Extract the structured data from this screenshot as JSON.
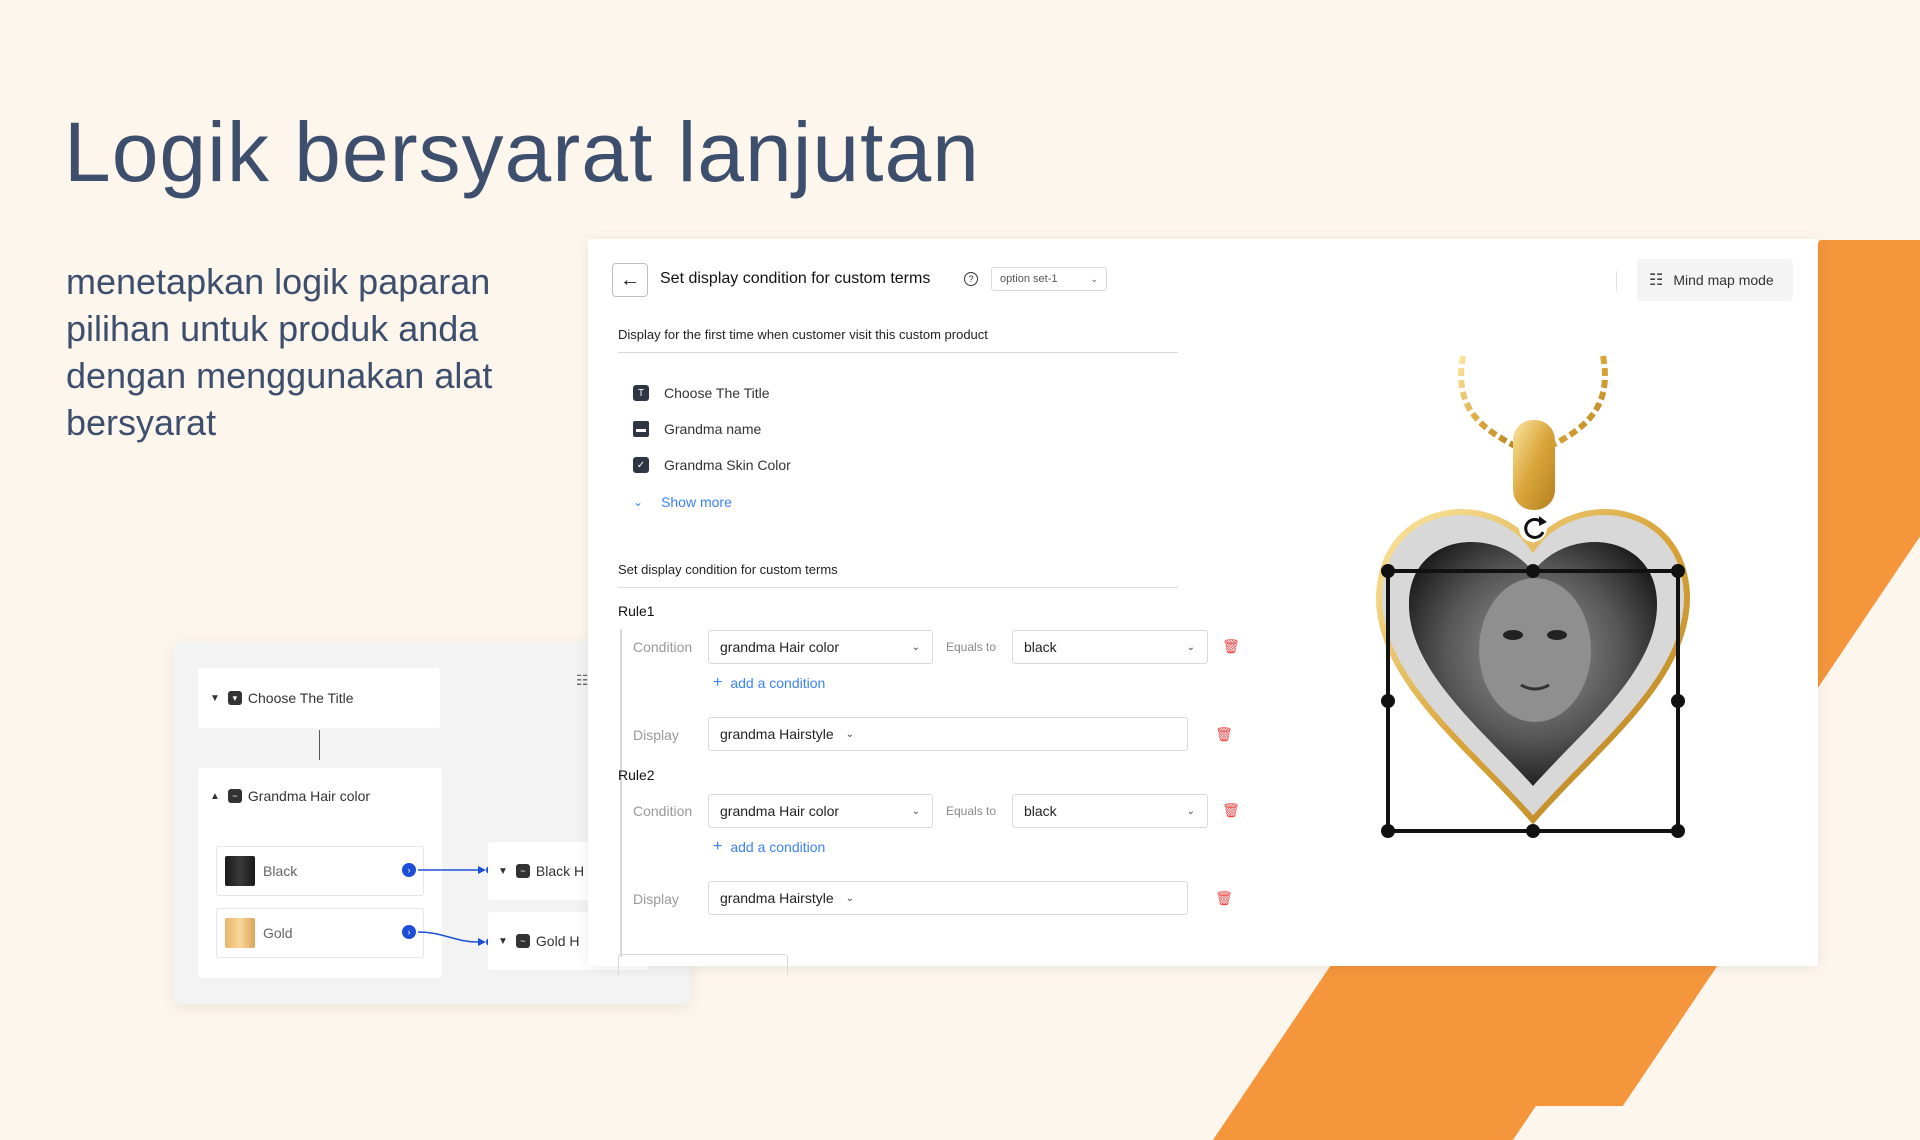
{
  "hero": {
    "title": "Logik bersyarat lanjutan",
    "description": "menetapkan logik paparan pilihan untuk produk anda dengan menggunakan alat bersyarat"
  },
  "colors": {
    "accent": "#f5963c",
    "title": "#3e4f6e",
    "link": "#3b82f6",
    "danger": "#ef4444"
  },
  "mindmap": {
    "root_label": "Choose The Title",
    "group_label": "Grandma Hair color",
    "choices": [
      {
        "label": "Black",
        "target": "Black H"
      },
      {
        "label": "Gold",
        "target": "Gold H"
      }
    ]
  },
  "panel": {
    "title": "Set display condition for custom terms",
    "option_set": "option set-1",
    "mind_map_button": "Mind map mode",
    "first_visit_label": "Display for the first time when customer visit this custom product",
    "terms": [
      {
        "label": "Choose The Title",
        "icon": "title-icon"
      },
      {
        "label": "Grandma name",
        "icon": "folder-icon"
      },
      {
        "label": "Grandma Skin Color",
        "icon": "checkbox-icon"
      }
    ],
    "show_more": "Show more",
    "condition_section_label": "Set display condition for custom terms",
    "rules": [
      {
        "name": "Rule1",
        "condition_label": "Condition",
        "condition_field": "grandma Hair color",
        "operator": "Equals to",
        "value": "black",
        "add_condition": "add a condition",
        "display_label": "Display",
        "display_value": "grandma Hairstyle"
      },
      {
        "name": "Rule2",
        "condition_label": "Condition",
        "condition_field": "grandma Hair color",
        "operator": "Equals to",
        "value": "black",
        "add_condition": "add a condition",
        "display_label": "Display",
        "display_value": "grandma Hairstyle"
      }
    ]
  }
}
